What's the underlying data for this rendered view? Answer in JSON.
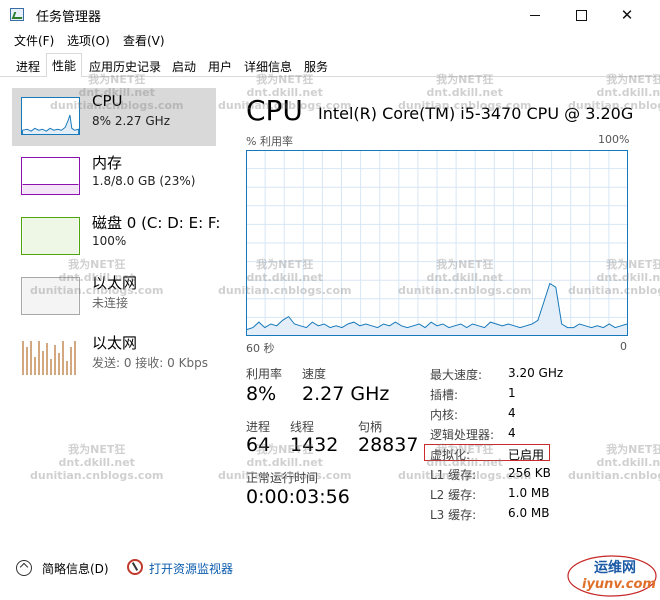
{
  "window": {
    "title": "任务管理器",
    "controls": {
      "minimize": "",
      "maximize": "",
      "close": "✕"
    }
  },
  "menu": [
    "文件(F)",
    "选项(O)",
    "查看(V)"
  ],
  "tabs": [
    {
      "label": "进程",
      "active": false
    },
    {
      "label": "性能",
      "active": true
    },
    {
      "label": "应用历史记录",
      "active": false
    },
    {
      "label": "启动",
      "active": false
    },
    {
      "label": "用户",
      "active": false
    },
    {
      "label": "详细信息",
      "active": false
    },
    {
      "label": "服务",
      "active": false
    }
  ],
  "sidebar": [
    {
      "title": "CPU",
      "sub": "8% 2.27 GHz",
      "selected": true,
      "color": "#1779ba"
    },
    {
      "title": "内存",
      "sub": "1.8/8.0 GB (23%)",
      "selected": false,
      "color": "#8b12ae"
    },
    {
      "title": "磁盘 0 (C: D: E: F:",
      "sub": "100%",
      "selected": false,
      "color": "#4da60c"
    },
    {
      "title": "以太网",
      "sub": "未连接",
      "selected": false,
      "color": "#a7a7a7"
    },
    {
      "title": "以太网",
      "sub": "发送: 0 接收: 0 Kbps",
      "selected": false,
      "color": "#a74f01"
    }
  ],
  "cpu": {
    "heading": "CPU",
    "model": "Intel(R) Core(TM) i5-3470 CPU @ 3.20GHz",
    "graph": {
      "y_label": "% 利用率",
      "y_max_label": "100%",
      "x_left_label": "60 秒",
      "x_right_label": "0",
      "line_color": "#1779ba",
      "fill_color": "#e3eef8",
      "samples": [
        3,
        4,
        7,
        4,
        6,
        5,
        8,
        10,
        6,
        5,
        4,
        7,
        5,
        6,
        4,
        5,
        4,
        6,
        7,
        5,
        6,
        5,
        4,
        6,
        5,
        7,
        5,
        4,
        5,
        6,
        4,
        7,
        5,
        6,
        4,
        5,
        6,
        4,
        6,
        5,
        4,
        7,
        6,
        5,
        6,
        5,
        4,
        5,
        6,
        8,
        18,
        28,
        26,
        6,
        4,
        4,
        6,
        5,
        4,
        5,
        4,
        6,
        4,
        5,
        6
      ]
    },
    "stats": {
      "utilization_label": "利用率",
      "utilization_value": "8%",
      "speed_label": "速度",
      "speed_value": "2.27 GHz",
      "processes_label": "进程",
      "processes_value": "64",
      "threads_label": "线程",
      "threads_value": "1432",
      "handles_label": "句柄",
      "handles_value": "28837",
      "uptime_label": "正常运行时间",
      "uptime_value": "0:00:03:56"
    },
    "specs": [
      {
        "k": "最大速度:",
        "v": "3.20 GHz"
      },
      {
        "k": "插槽:",
        "v": "1"
      },
      {
        "k": "内核:",
        "v": "4"
      },
      {
        "k": "逻辑处理器:",
        "v": "4"
      },
      {
        "k": "虚拟化:",
        "v": "已启用"
      },
      {
        "k": "L1 缓存:",
        "v": "256 KB"
      },
      {
        "k": "L2 缓存:",
        "v": "1.0 MB"
      },
      {
        "k": "L3 缓存:",
        "v": "6.0 MB"
      }
    ]
  },
  "bottom": {
    "fewer_details": "简略信息(D)",
    "open_resmon": "打开资源监视器"
  },
  "watermark": {
    "line1": "我为NET狂",
    "line2": "dnt.dkill.net",
    "line3": "dunitian.cnblogs.com"
  },
  "logo": {
    "name": "运维网",
    "url": "iyunv.com"
  }
}
